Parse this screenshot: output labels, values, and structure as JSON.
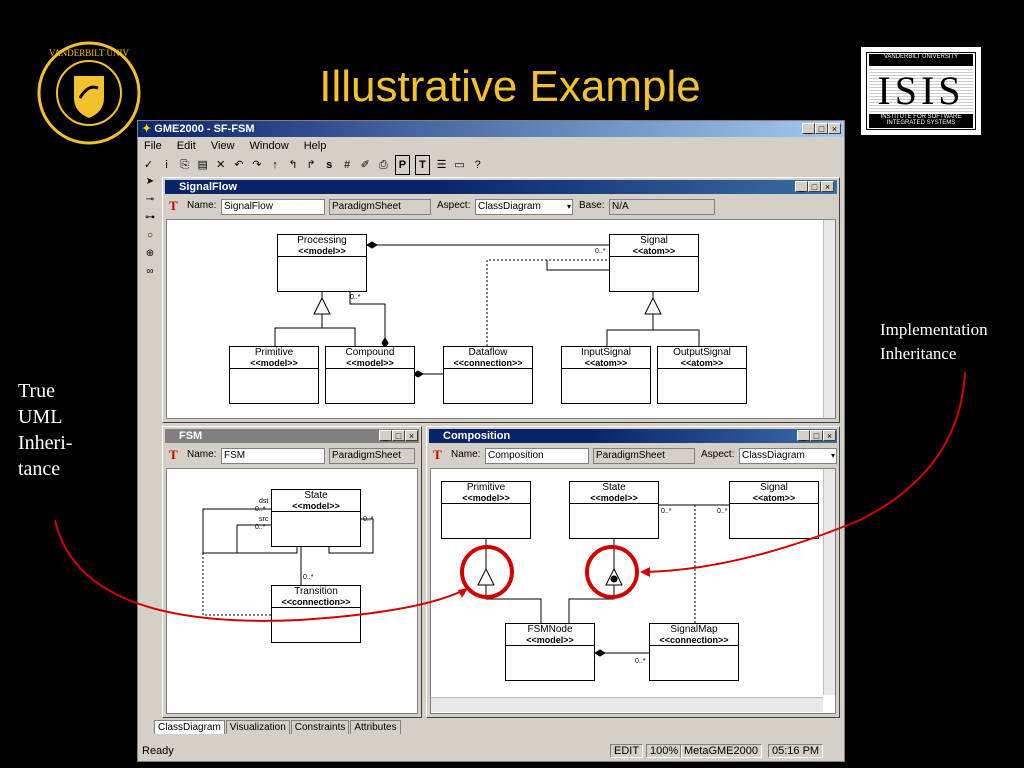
{
  "slide": {
    "title": "Illustrative Example",
    "left_note": [
      "True",
      "UML",
      "Inheri-",
      "tance"
    ],
    "right_note": [
      "Implementation",
      "Inheritance"
    ],
    "logo_left_text": "VANDERBILT UNIVERSITY",
    "logo_right": {
      "top": "VANDERBILT UNIVERSITY",
      "mid": "ISIS",
      "bottom": "INSTITUTE FOR SOFTWARE INTEGRATED SYSTEMS"
    },
    "colors": {
      "background": "#000000",
      "title": "#f2c12e",
      "callout": "#d00000"
    }
  },
  "app": {
    "title": "GME2000 - SF-FSM",
    "menu": [
      "File",
      "Edit",
      "View",
      "Window",
      "Help"
    ],
    "toolbar_icons": [
      "check-icon",
      "info-icon",
      "copy-icon",
      "paste-icon",
      "delete-icon",
      "undo-icon",
      "redo-icon",
      "up-icon",
      "up-left-icon",
      "up-right-icon",
      "s-icon",
      "grid-icon",
      "brush-icon",
      "print-icon",
      "p-icon",
      "t-icon",
      "lines-icon",
      "frame-icon",
      "help-icon"
    ],
    "left_tools": [
      "pointer-icon",
      "connect-icon",
      "disconnect-icon",
      "lasso-icon",
      "zoom-icon",
      "link-icon"
    ],
    "windows": {
      "signalflow": {
        "title": "SignalFlow",
        "name_label": "Name:",
        "name_value": "SignalFlow",
        "paradigm": "ParadigmSheet",
        "aspect_label": "Aspect:",
        "aspect_value": "ClassDiagram",
        "base_label": "Base:",
        "base_value": "N/A",
        "boxes": [
          {
            "name": "Processing",
            "stereo": "<<model>>"
          },
          {
            "name": "Signal",
            "stereo": "<<atom>>"
          },
          {
            "name": "Primitive",
            "stereo": "<<model>>"
          },
          {
            "name": "Compound",
            "stereo": "<<model>>"
          },
          {
            "name": "Dataflow",
            "stereo": "<<connection>>"
          },
          {
            "name": "InputSignal",
            "stereo": "<<atom>>"
          },
          {
            "name": "OutputSignal",
            "stereo": "<<atom>>"
          }
        ],
        "mult": [
          "0..*",
          "0..*"
        ]
      },
      "fsm": {
        "title": "FSM",
        "name_label": "Name:",
        "name_value": "FSM",
        "paradigm": "ParadigmSheet",
        "boxes": [
          {
            "name": "State",
            "stereo": "<<model>>"
          },
          {
            "name": "Transition",
            "stereo": "<<connection>>"
          }
        ],
        "roles": [
          "dst",
          "0..*",
          "src",
          "0..*",
          "0..*",
          "0..*"
        ]
      },
      "composition": {
        "title": "Composition",
        "name_label": "Name:",
        "name_value": "Composition",
        "paradigm": "ParadigmSheet",
        "aspect_label": "Aspect:",
        "aspect_value": "ClassDiagram",
        "boxes": [
          {
            "name": "Primitive",
            "stereo": "<<model>>"
          },
          {
            "name": "State",
            "stereo": "<<model>>"
          },
          {
            "name": "Signal",
            "stereo": "<<atom>>"
          },
          {
            "name": "FSMNode",
            "stereo": "<<model>>"
          },
          {
            "name": "SignalMap",
            "stereo": "<<connection>>"
          }
        ],
        "mult": [
          "0..*",
          "0..*",
          "0..*"
        ]
      }
    },
    "tabs": [
      "ClassDiagram",
      "Visualization",
      "Constraints",
      "Attributes"
    ],
    "status": {
      "left": "Ready",
      "mode": "EDIT",
      "zoom": "100%",
      "paradigm": "MetaGME2000",
      "time": "05:16  PM"
    }
  }
}
